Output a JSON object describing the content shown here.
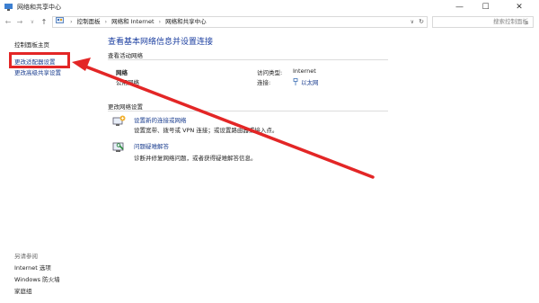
{
  "window": {
    "title": "网络和共享中心",
    "minimize": "—",
    "maximize": "☐",
    "close": "✕"
  },
  "address": {
    "back": "←",
    "forward": "→",
    "up": "↑",
    "crumbs": [
      "控制面板",
      "网络和 Internet",
      "网络和共享中心"
    ],
    "search_placeholder": "搜索控制面板"
  },
  "sidebar": {
    "home": "控制面板主页",
    "change_adapter": "更改适配器设置",
    "change_sharing": "更改高级共享设置",
    "see_also_title": "另请参阅",
    "see_also": [
      "Internet 选项",
      "Windows 防火墙",
      "家庭组"
    ]
  },
  "main": {
    "title": "查看基本网络信息并设置连接",
    "active_section": "查看活动网络",
    "network_name": "网络",
    "network_type": "公用网络",
    "access_type_label": "访问类型:",
    "access_type_value": "Internet",
    "connections_label": "连接:",
    "connections_value": "以太网",
    "change_section": "更改网络设置",
    "tasks": [
      {
        "link": "设置新的连接或网络",
        "desc": "设置宽带、拨号或 VPN 连接；或设置路由器或接入点。"
      },
      {
        "link": "问题疑难解答",
        "desc": "诊断并修复网络问题，或者获得疑难解答信息。"
      }
    ]
  },
  "annotation": {
    "highlight_color": "#e32626"
  },
  "colors": {
    "link": "#1a3d8f",
    "title": "#1c3fa0"
  }
}
